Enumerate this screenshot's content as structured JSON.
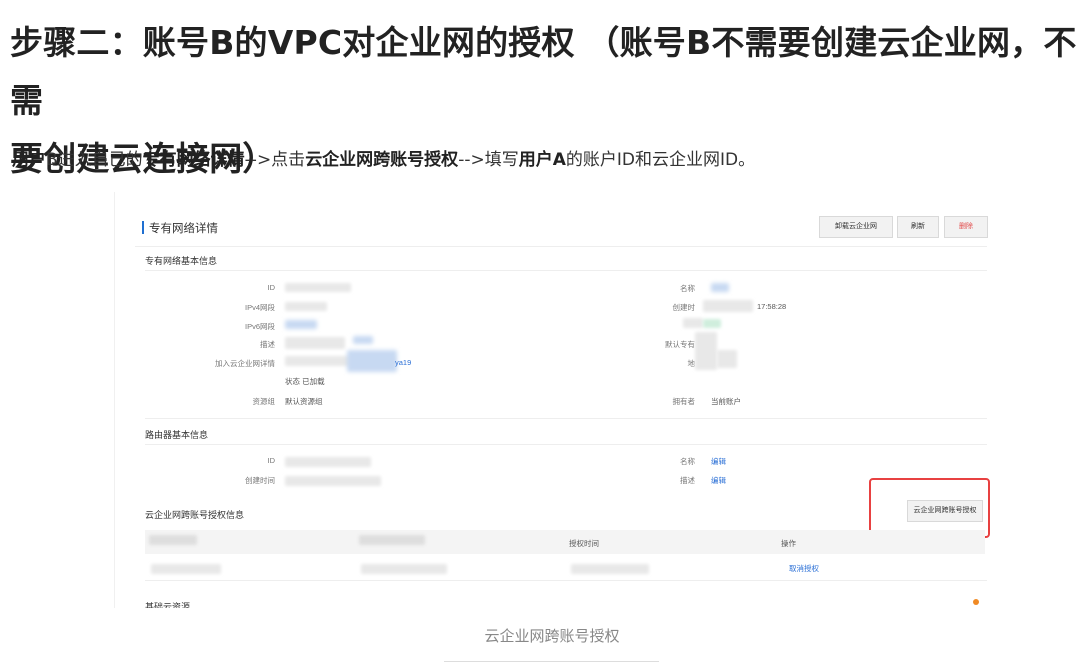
{
  "heading": {
    "line1": "步骤二：账号B的VPC对企业网的授权 （账号B不需要创建云企业网，不需",
    "line2": "要创建云连接网）"
  },
  "paragraph": {
    "parts": [
      {
        "text": "用户",
        "bold": true
      },
      {
        "text": "B进入自己的",
        "bold": false
      },
      {
        "text": "专有网络详情",
        "bold": true
      },
      {
        "text": "-->点击",
        "bold": false
      },
      {
        "text": "云企业网跨账号授权",
        "bold": true
      },
      {
        "text": "-->填写",
        "bold": false
      },
      {
        "text": "用户A",
        "bold": true
      },
      {
        "text": "的账户ID和云企业网ID。",
        "bold": false
      }
    ]
  },
  "screenshot": {
    "page_title": "专有网络详情",
    "buttons": {
      "attach": "卸载云企业网",
      "refresh": "刷新",
      "delete": "删除"
    },
    "vpc_section": "专有网络基本信息",
    "vpc_left_labels": [
      "ID",
      "IPv4网段",
      "IPv6网段",
      "描述",
      "加入云企业网详情",
      "资源组"
    ],
    "vpc_right_labels": [
      "名称",
      "创建时",
      "",
      "默认专有",
      "地",
      "拥有者"
    ],
    "cen_link_suffix": "ya19",
    "cen_status": "状态 已加载",
    "create_time_fragment": "17:58:28",
    "resource_group_value": "默认资源组",
    "owner_value": "当前账户",
    "region_fragment": "",
    "router_section": "路由器基本信息",
    "router_left_labels": [
      "ID",
      "创建时间"
    ],
    "router_right_labels": [
      "名称",
      "描述"
    ],
    "edit_label": "编辑",
    "auth_section": "云企业网跨账号授权信息",
    "auth_button": "云企业网跨账号授权",
    "table_headers": [
      "对方阿里云账号UID",
      "对方云企业网实例ID",
      "授权时间",
      "操作"
    ],
    "revoke_link": "取消授权",
    "next_section": "基础云资源"
  },
  "caption": "云企业网跨账号授权",
  "colors": {
    "accent": "#1f6fd1",
    "highlight": "#e84141",
    "link": "#2a6fd6"
  }
}
